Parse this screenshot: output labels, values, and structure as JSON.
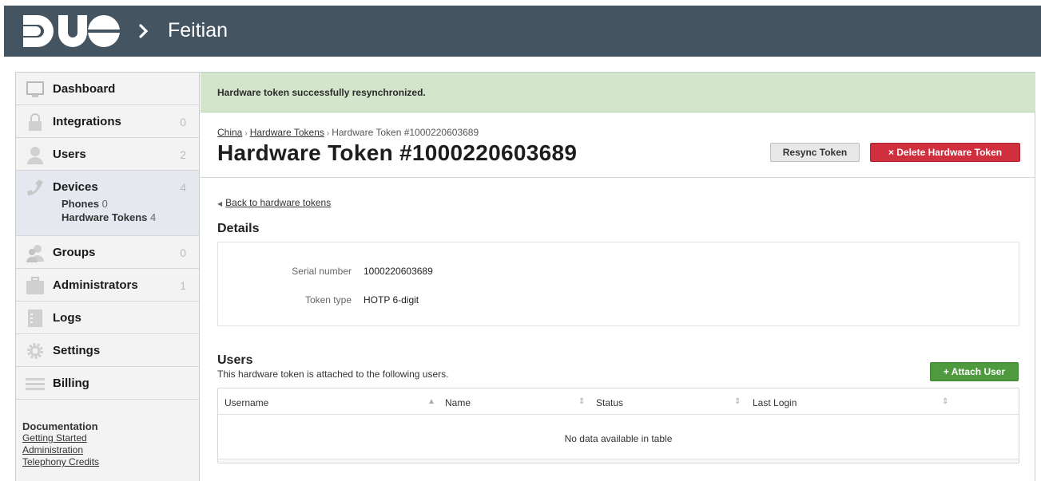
{
  "header": {
    "brand": "DUO",
    "account": "Feitian"
  },
  "sidebar": {
    "items": [
      {
        "label": "Dashboard",
        "count": "",
        "icon": "monitor-icon"
      },
      {
        "label": "Integrations",
        "count": "0",
        "icon": "lock-icon"
      },
      {
        "label": "Users",
        "count": "2",
        "icon": "user-icon"
      },
      {
        "label": "Devices",
        "count": "4",
        "icon": "phone-icon"
      },
      {
        "label": "Groups",
        "count": "0",
        "icon": "group-icon"
      },
      {
        "label": "Administrators",
        "count": "1",
        "icon": "briefcase-icon"
      },
      {
        "label": "Logs",
        "count": "",
        "icon": "list-icon"
      },
      {
        "label": "Settings",
        "count": "",
        "icon": "gear-icon"
      },
      {
        "label": "Billing",
        "count": "",
        "icon": "billing-icon"
      }
    ],
    "devices_sub": [
      {
        "label": "Phones",
        "count": "0"
      },
      {
        "label": "Hardware Tokens",
        "count": "4"
      }
    ],
    "docs": {
      "heading": "Documentation",
      "links": [
        "Getting Started",
        "Administration",
        "Telephony Credits"
      ]
    }
  },
  "flash": "Hardware token successfully resynchronized.",
  "breadcrumb": [
    "China",
    "Hardware Tokens",
    "Hardware Token #1000220603689"
  ],
  "title": "Hardware Token #1000220603689",
  "buttons": {
    "resync": "Resync Token",
    "delete": "× Delete Hardware Token",
    "attach": "+ Attach User"
  },
  "back_link": "Back to hardware tokens",
  "details": {
    "heading": "Details",
    "rows": [
      {
        "key": "Serial number",
        "value": "1000220603689"
      },
      {
        "key": "Token type",
        "value": "HOTP 6-digit"
      }
    ]
  },
  "users": {
    "heading": "Users",
    "subtitle": "This hardware token is attached to the following users.",
    "columns": [
      "Username",
      "Name",
      "Status",
      "Last Login"
    ],
    "empty_text": "No data available in table"
  }
}
